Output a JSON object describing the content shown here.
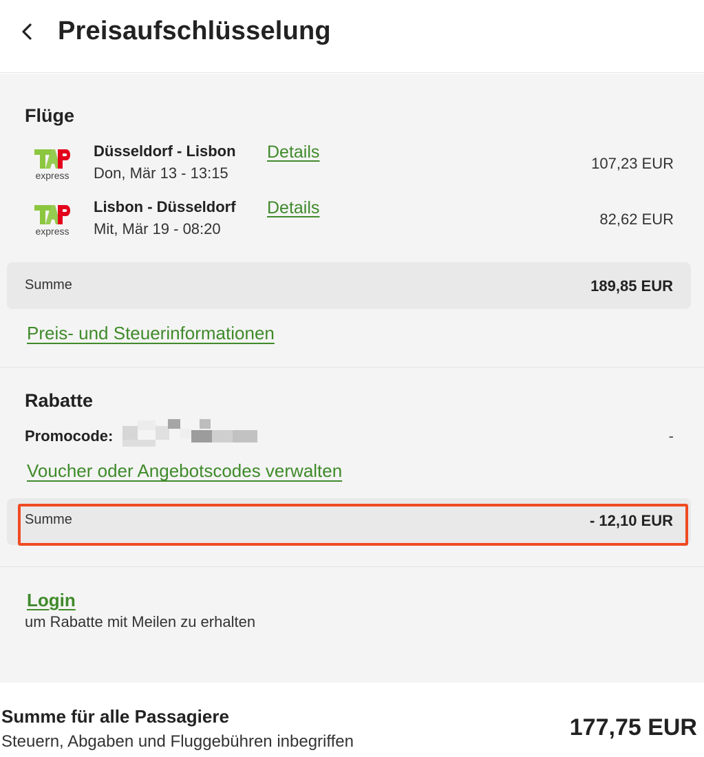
{
  "header": {
    "title": "Preisaufschlüsselung",
    "back_icon": "chevron-left-icon"
  },
  "flights": {
    "title": "Flüge",
    "items": [
      {
        "airline_logo": "TAP express",
        "logo_subtext": "express",
        "route": "Düsseldorf - Lisbon",
        "datetime": "Don, Mär 13 - 13:15",
        "details_label": "Details",
        "price": "107,23 EUR"
      },
      {
        "airline_logo": "TAP express",
        "logo_subtext": "express",
        "route": "Lisbon - Düsseldorf",
        "datetime": "Mit, Mär 19 - 08:20",
        "details_label": "Details",
        "price": "82,62 EUR"
      }
    ],
    "sum_label": "Summe",
    "sum_value": "189,85 EUR",
    "info_link": "Preis- und Steuerinformationen"
  },
  "discounts": {
    "title": "Rabatte",
    "promo_label": "Promocode:",
    "promo_value": "-",
    "voucher_link": "Voucher oder Angebotscodes verwalten",
    "sum_label": "Summe",
    "sum_value": "- 12,10 EUR"
  },
  "login": {
    "link": "Login",
    "subtext": "um Rabatte mit Meilen zu erhalten"
  },
  "footer": {
    "title": "Summe für alle Passagiere",
    "subtitle": "Steuern, Abgaben und Fluggebühren inbegriffen",
    "total": "177,75 EUR"
  },
  "colors": {
    "link_green": "#3f8a2a",
    "highlight": "#f04a23",
    "tap_green": "#8cc63f",
    "tap_red": "#e3001b"
  }
}
